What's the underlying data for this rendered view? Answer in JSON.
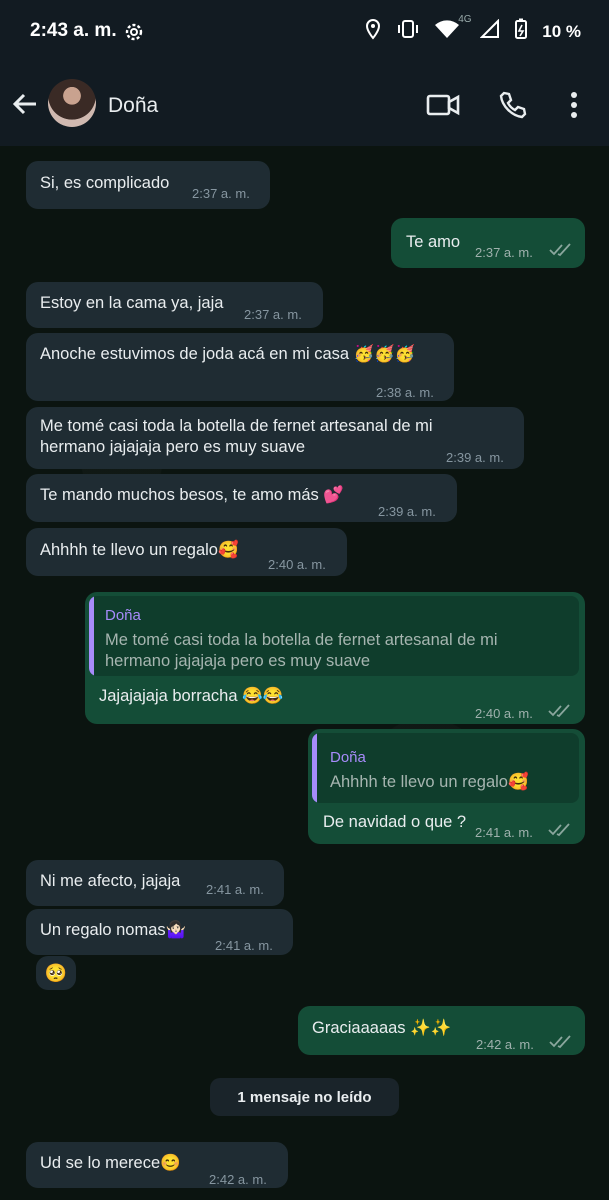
{
  "status_bar": {
    "time": "2:43 a. m.",
    "network": "4G",
    "battery": "10 %"
  },
  "header": {
    "contact_name": "Doña",
    "icons": [
      "back-arrow-icon",
      "video-call-icon",
      "phone-icon",
      "more-vert-icon"
    ]
  },
  "colors": {
    "incoming_bubble": "#1f2c33",
    "outgoing_bubble": "#144d37",
    "quote_accent": "#a78bfa",
    "background": "#0b1410"
  },
  "messages": [
    {
      "dir": "in",
      "text": "Si, es complicado",
      "time": "2:37 a. m."
    },
    {
      "dir": "out",
      "text": "Te amo",
      "time": "2:37 a. m."
    },
    {
      "dir": "in",
      "text": "Estoy en la cama ya, jaja",
      "time": "2:37 a. m."
    },
    {
      "dir": "in",
      "text": "Anoche estuvimos de joda acá en mi casa 🥳🥳🥳",
      "time": "2:38 a. m."
    },
    {
      "dir": "in",
      "text_line1": "Me tomé casi toda la botella de fernet artesanal de mi",
      "text_line2": "hermano jajajaja pero es muy suave",
      "time": "2:39 a. m."
    },
    {
      "dir": "in",
      "text": "Te mando muchos besos, te amo más 💕",
      "time": "2:39 a. m."
    },
    {
      "dir": "in",
      "text": "Ahhhh te llevo un regalo🥰",
      "time": "2:40 a. m."
    },
    {
      "dir": "out",
      "quote_name": "Doña",
      "quote_line1": "Me tomé casi toda la botella de fernet artesanal de mi",
      "quote_line2": "hermano jajajaja pero es muy suave",
      "text": "Jajajajaja borracha 😂😂",
      "time": "2:40 a. m."
    },
    {
      "dir": "out",
      "quote_name": "Doña",
      "quote_text": "Ahhhh te llevo un regalo🥰",
      "text": "De navidad o que ?",
      "time": "2:41 a. m."
    },
    {
      "dir": "in",
      "text": "Ni me afecto, jajaja",
      "time": "2:41 a. m."
    },
    {
      "dir": "in",
      "text": "Un regalo nomas🤷🏻‍♀️",
      "time": "2:41 a. m.",
      "reaction": "🥺"
    },
    {
      "dir": "out",
      "text": "Graciaaaaas ✨✨",
      "time": "2:42 a. m."
    },
    {
      "dir": "in",
      "text": "Ud se lo merece😊",
      "time": "2:42 a. m."
    }
  ],
  "unread_divider": "1 mensaje no leído"
}
